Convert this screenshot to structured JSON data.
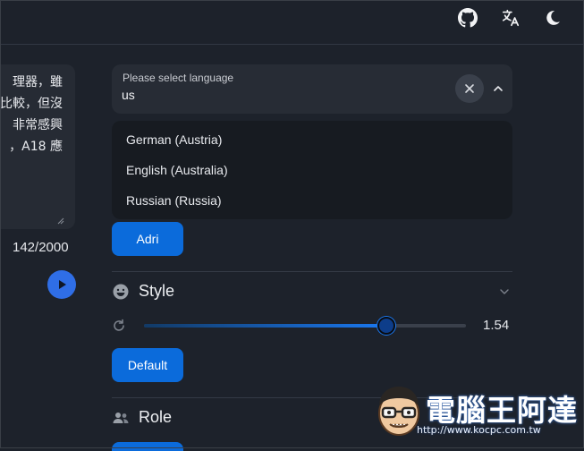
{
  "header": {
    "icons": [
      "github-icon",
      "translate-icon",
      "moon-icon"
    ]
  },
  "input_panel": {
    "text_lines": [
      "理器，雖",
      "比較，但沒",
      "非常感興",
      "，A18 應"
    ],
    "char_count": "142/2000"
  },
  "language_select": {
    "label": "Please select language",
    "value": "us",
    "options": [
      "German (Austria)",
      "English (Australia)",
      "Russian (Russia)"
    ]
  },
  "voice": {
    "button_label": "Adri"
  },
  "style_section": {
    "title": "Style",
    "slider_value": "1.54",
    "slider_fraction": 0.75,
    "default_button": "Default"
  },
  "role_section": {
    "title": "Role"
  },
  "watermark": {
    "text": "電腦王阿達",
    "url": "http://www.kocpc.com.tw"
  },
  "colors": {
    "background": "#1d222b",
    "panel": "#272c35",
    "accent": "#0b6bdb",
    "play": "#2f6ee6"
  }
}
